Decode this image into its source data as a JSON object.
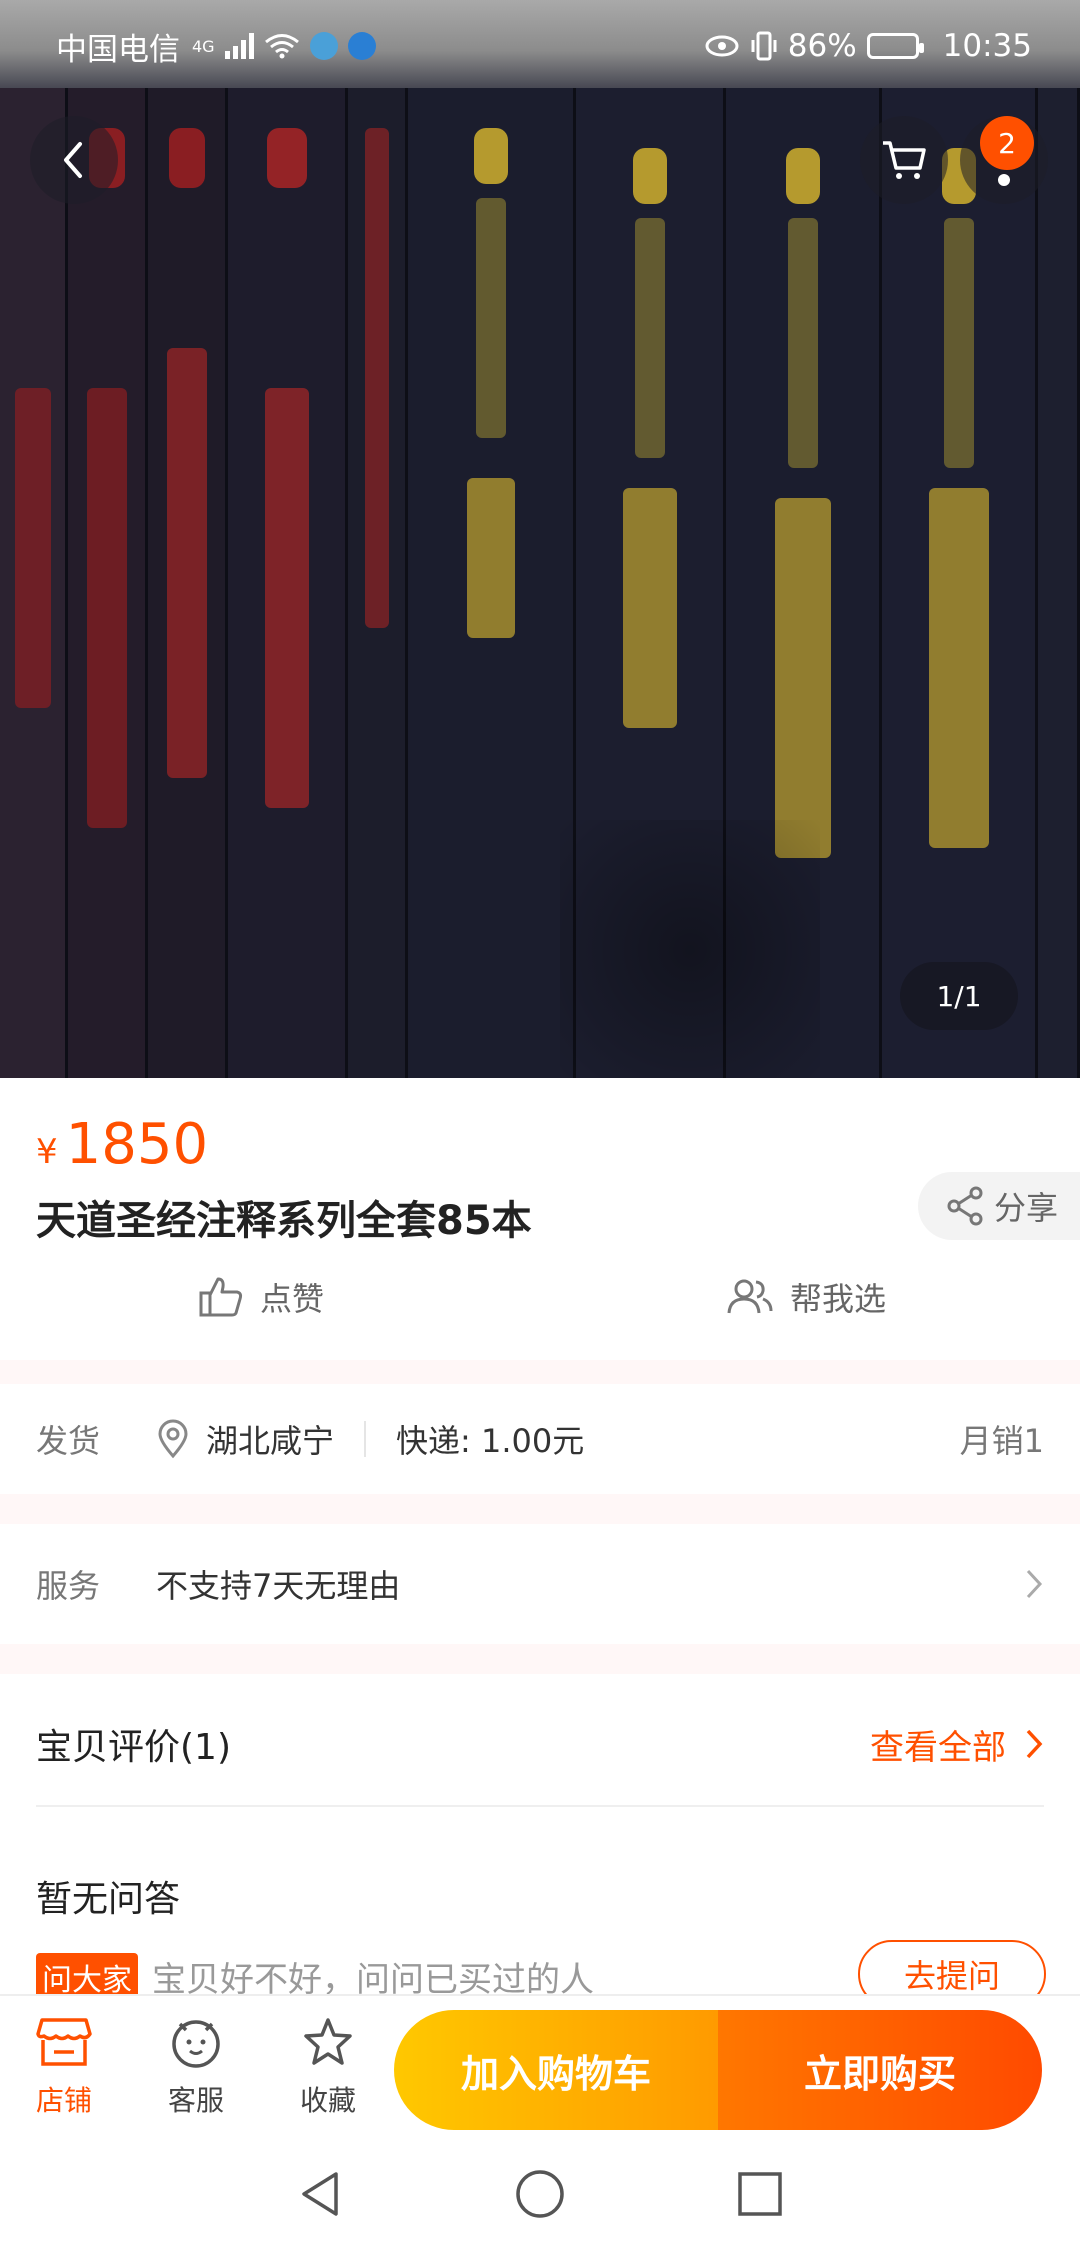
{
  "status_bar": {
    "carrier": "中国电信",
    "network": "4G",
    "battery": "86%",
    "time": "10:35"
  },
  "hero": {
    "cart_count": "2",
    "page_indicator": "1/1"
  },
  "product": {
    "currency": "¥",
    "price": "1850",
    "title": "天道圣经注释系列全套85本",
    "share_label": "分享",
    "like_label": "点赞",
    "help_choose_label": "帮我选"
  },
  "shipping": {
    "label": "发货",
    "location": "湖北咸宁",
    "express": "快递: 1.00元",
    "monthly_sales": "月销1"
  },
  "service": {
    "label": "服务",
    "value": "不支持7天无理由"
  },
  "reviews": {
    "title": "宝贝评价(1)",
    "view_all": "查看全部"
  },
  "qa": {
    "title": "暂无问答",
    "tag": "问大家",
    "prompt": "宝贝好不好，问问已买过的人",
    "ask_button": "去提问"
  },
  "bottom_bar": {
    "store": "店铺",
    "service": "客服",
    "favorite": "收藏",
    "add_to_cart": "加入购物车",
    "buy_now": "立即购买"
  },
  "colors": {
    "accent": "#ff5000",
    "cart_gradient_start": "#ffc800",
    "buy_gradient_end": "#ff4a00"
  }
}
